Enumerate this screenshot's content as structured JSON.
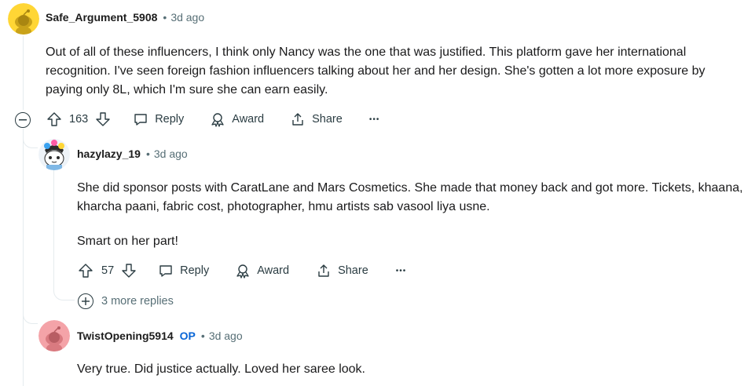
{
  "comments": [
    {
      "username": "Safe_Argument_5908",
      "dot": "•",
      "time": "3d ago",
      "text": "Out of all of these influencers, I think only Nancy was the one that was justified. This platform gave her international recognition. I've seen foreign fashion influencers talking about her and her design. She's gotten a lot more exposure by paying only 8L, which I'm sure she can earn easily.",
      "votes": "163",
      "reply_label": "Reply",
      "award_label": "Award",
      "share_label": "Share",
      "more_label": "•••",
      "avatar_color": "#ffd635"
    },
    {
      "username": "hazylazy_19",
      "dot": "•",
      "time": "3d ago",
      "text_p1": "She did sponsor posts with CaratLane and Mars Cosmetics. She made that money back and got more. Tickets, khaana, kharcha paani, fabric cost, photographer, hmu artists sab vasool liya usne.",
      "text_p2": "Smart on her part!",
      "votes": "57",
      "reply_label": "Reply",
      "award_label": "Award",
      "share_label": "Share",
      "more_label": "•••",
      "more_replies": "3 more replies"
    },
    {
      "username": "TwistOpening5914",
      "op_badge": "OP",
      "dot": "•",
      "time": "3d ago",
      "text": "Very true. Did justice actually. Loved her saree look.",
      "avatar_color": "#f4a3a8"
    }
  ],
  "icons": {
    "collapse": "minus-circle-icon",
    "upvote": "upvote-arrow-icon",
    "downvote": "downvote-arrow-icon",
    "reply": "speech-bubble-icon",
    "award": "award-ribbon-icon",
    "share": "share-upload-icon",
    "more": "ellipsis-icon",
    "expand": "plus-circle-icon"
  }
}
